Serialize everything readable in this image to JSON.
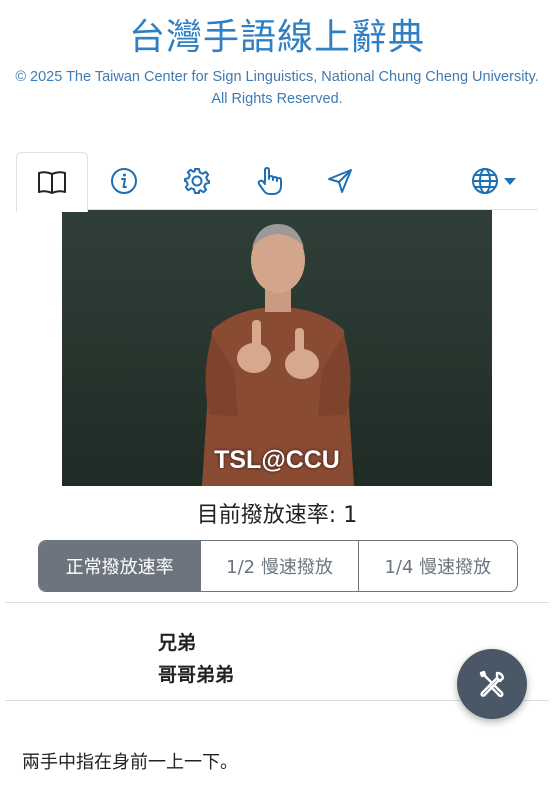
{
  "header": {
    "title": "台灣手語線上辭典",
    "copyright": "© 2025 The Taiwan Center for Sign Linguistics, National Chung Cheng University. All Rights Reserved."
  },
  "tabs": [
    {
      "icon": "book-icon",
      "active": true
    },
    {
      "icon": "info-icon",
      "active": false
    },
    {
      "icon": "gear-icon",
      "active": false
    },
    {
      "icon": "hand-pointer-icon",
      "active": false
    },
    {
      "icon": "send-icon",
      "active": false
    }
  ],
  "language_menu": {
    "icon": "globe-icon",
    "caret": "caret-down-icon"
  },
  "video": {
    "watermark": "TSL@CCU"
  },
  "playback": {
    "label": "目前撥放速率: 1",
    "buttons": [
      "正常撥放速率",
      "1/2 慢速撥放",
      "1/4 慢速撥放"
    ],
    "active_index": 0
  },
  "entry": {
    "words": [
      "兄弟",
      "哥哥弟弟"
    ],
    "description": "兩手中指在身前一上一下。"
  },
  "tools_button": {
    "icon": "tools-icon"
  },
  "colors": {
    "title": "#2e7fc4",
    "accent": "#1f6fb5",
    "button_active": "#6c757d",
    "fab": "#4a5766"
  }
}
